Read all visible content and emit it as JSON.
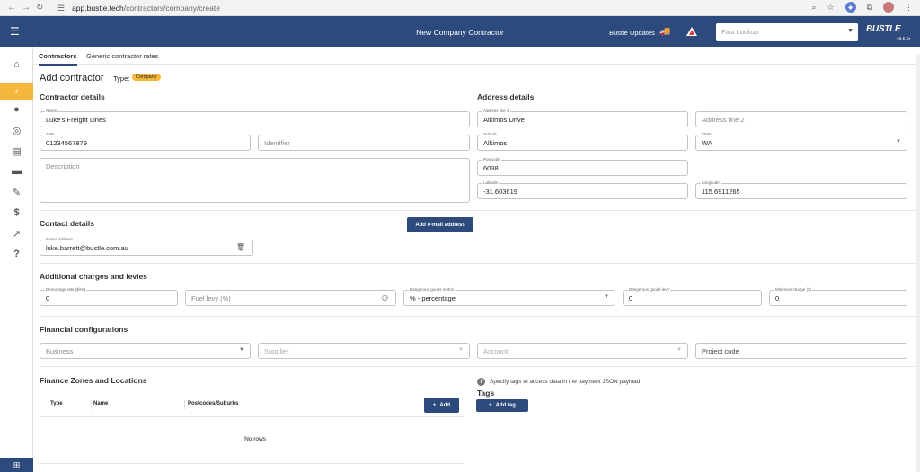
{
  "browser": {
    "url_host": "app.bustle.tech",
    "url_path": "/contractors/company/create"
  },
  "header": {
    "title": "New Company Contractor",
    "updates_label": "Bustle Updates",
    "lookup_placeholder": "Fast Lookup",
    "logo": "BUSTLE",
    "version": "v3.5.9r"
  },
  "tabs": [
    {
      "label": "Contractors"
    },
    {
      "label": "Generic contractor rates"
    }
  ],
  "page": {
    "title": "Add contractor",
    "type_label": "Type:",
    "type_value": "Company"
  },
  "contractor_details": {
    "heading": "Contractor details",
    "name_label": "Name",
    "name_value": "Luke's Freight Lines",
    "abn_label": "ABN",
    "abn_value": "01234567879",
    "identifier_placeholder": "Identifier",
    "description_placeholder": "Description"
  },
  "address_details": {
    "heading": "Address details",
    "line1_label": "Address line 1",
    "line1_value": "Alkimos Drive",
    "line2_placeholder": "Address line 2",
    "suburb_label": "Suburb",
    "suburb_value": "Alkimos",
    "state_label": "State",
    "state_value": "WA",
    "postcode_label": "Postcode",
    "postcode_value": "6038",
    "latitude_label": "Latitude",
    "latitude_value": "-31.603619",
    "longitude_label": "Longitude",
    "longitude_value": "115.6911265"
  },
  "contact_details": {
    "heading": "Contact details",
    "add_email_label": "Add e-mail address",
    "email_label": "E-mail address",
    "email_value": "luke.barrett@bustle.com.au"
  },
  "charges": {
    "heading": "Additional charges and levies",
    "demurrage_label": "Demurrage rate ($/Hr)",
    "demurrage_value": "0",
    "fuel_placeholder": "Fuel levy (%)",
    "dg_metric_label": "Dangerous goods metric",
    "dg_metric_value": "% - percentage",
    "dg_levy_label": "Dangerous goods levy",
    "dg_levy_value": "0",
    "min_charge_label": "Minimum charge ($)",
    "min_charge_value": "0"
  },
  "financial": {
    "heading": "Financial configurations",
    "business_placeholder": "Business",
    "supplier_placeholder": "Supplier",
    "account_placeholder": "Account",
    "project_placeholder": "Project code"
  },
  "zones": {
    "heading": "Finance Zones and Locations",
    "add_label": "Add",
    "col_type": "Type",
    "col_name": "Name",
    "col_postcodes": "Postcodes/Suburbs",
    "empty_text": "No rows"
  },
  "tags": {
    "info_text": "Specify tags to access data in the payment JSON payload",
    "heading": "Tags",
    "add_label": "Add tag"
  }
}
